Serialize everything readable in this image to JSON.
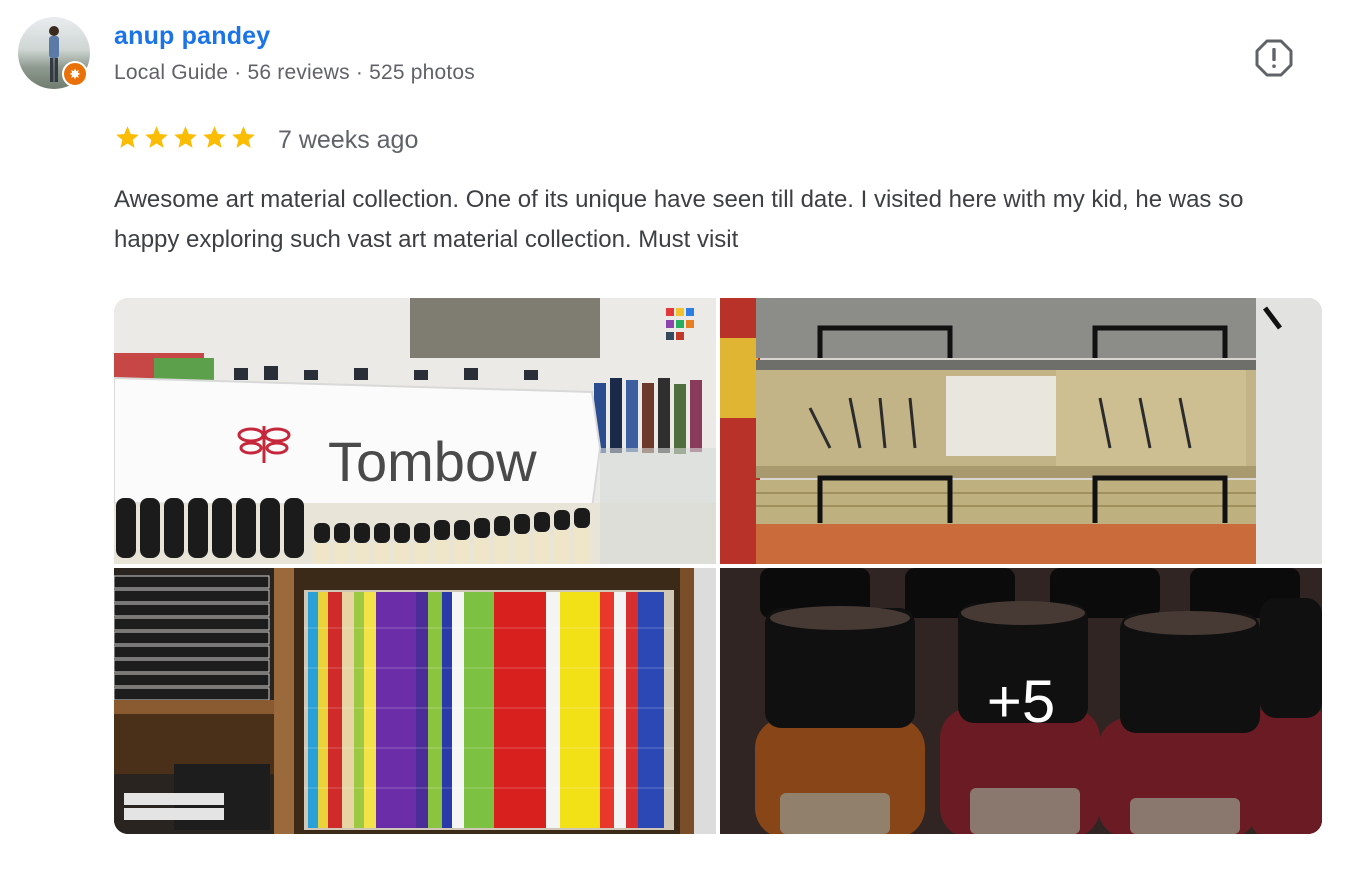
{
  "reviewer": {
    "name": "anup pandey",
    "guide_label": "Local Guide",
    "reviews": "56 reviews",
    "photos": "525 photos",
    "separator": "·"
  },
  "review": {
    "rating": 5,
    "time": "7 weeks ago",
    "text": "Awesome art material collection. One of its unique have seen till date. I visited here with my kid, he was so happy exploring such vast art material collection. Must visit"
  },
  "photos": {
    "photo1_sign": "Tombow",
    "more_count": "+5"
  },
  "icons": {
    "report": "report-flag-icon",
    "badge": "local-guide-badge-icon",
    "star": "star-icon"
  },
  "colors": {
    "name": "#1a73e8",
    "star": "#fbbc04",
    "meta": "#5f6368",
    "badge": "#e8710a"
  }
}
